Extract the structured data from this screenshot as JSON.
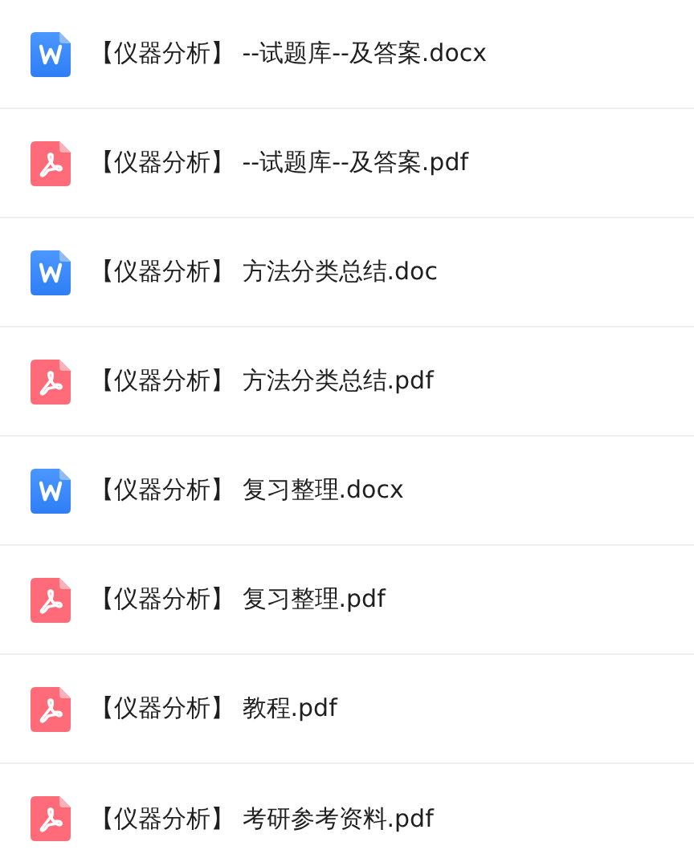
{
  "files": [
    {
      "kind": "word",
      "name": "【仪器分析】 --试题库--及答案.docx"
    },
    {
      "kind": "pdf",
      "name": "【仪器分析】 --试题库--及答案.pdf"
    },
    {
      "kind": "word",
      "name": "【仪器分析】 方法分类总结.doc"
    },
    {
      "kind": "pdf",
      "name": "【仪器分析】 方法分类总结.pdf"
    },
    {
      "kind": "word",
      "name": "【仪器分析】 复习整理.docx"
    },
    {
      "kind": "pdf",
      "name": "【仪器分析】 复习整理.pdf"
    },
    {
      "kind": "pdf",
      "name": "【仪器分析】 教程.pdf"
    },
    {
      "kind": "pdf",
      "name": "【仪器分析】 考研参考资料.pdf"
    }
  ]
}
